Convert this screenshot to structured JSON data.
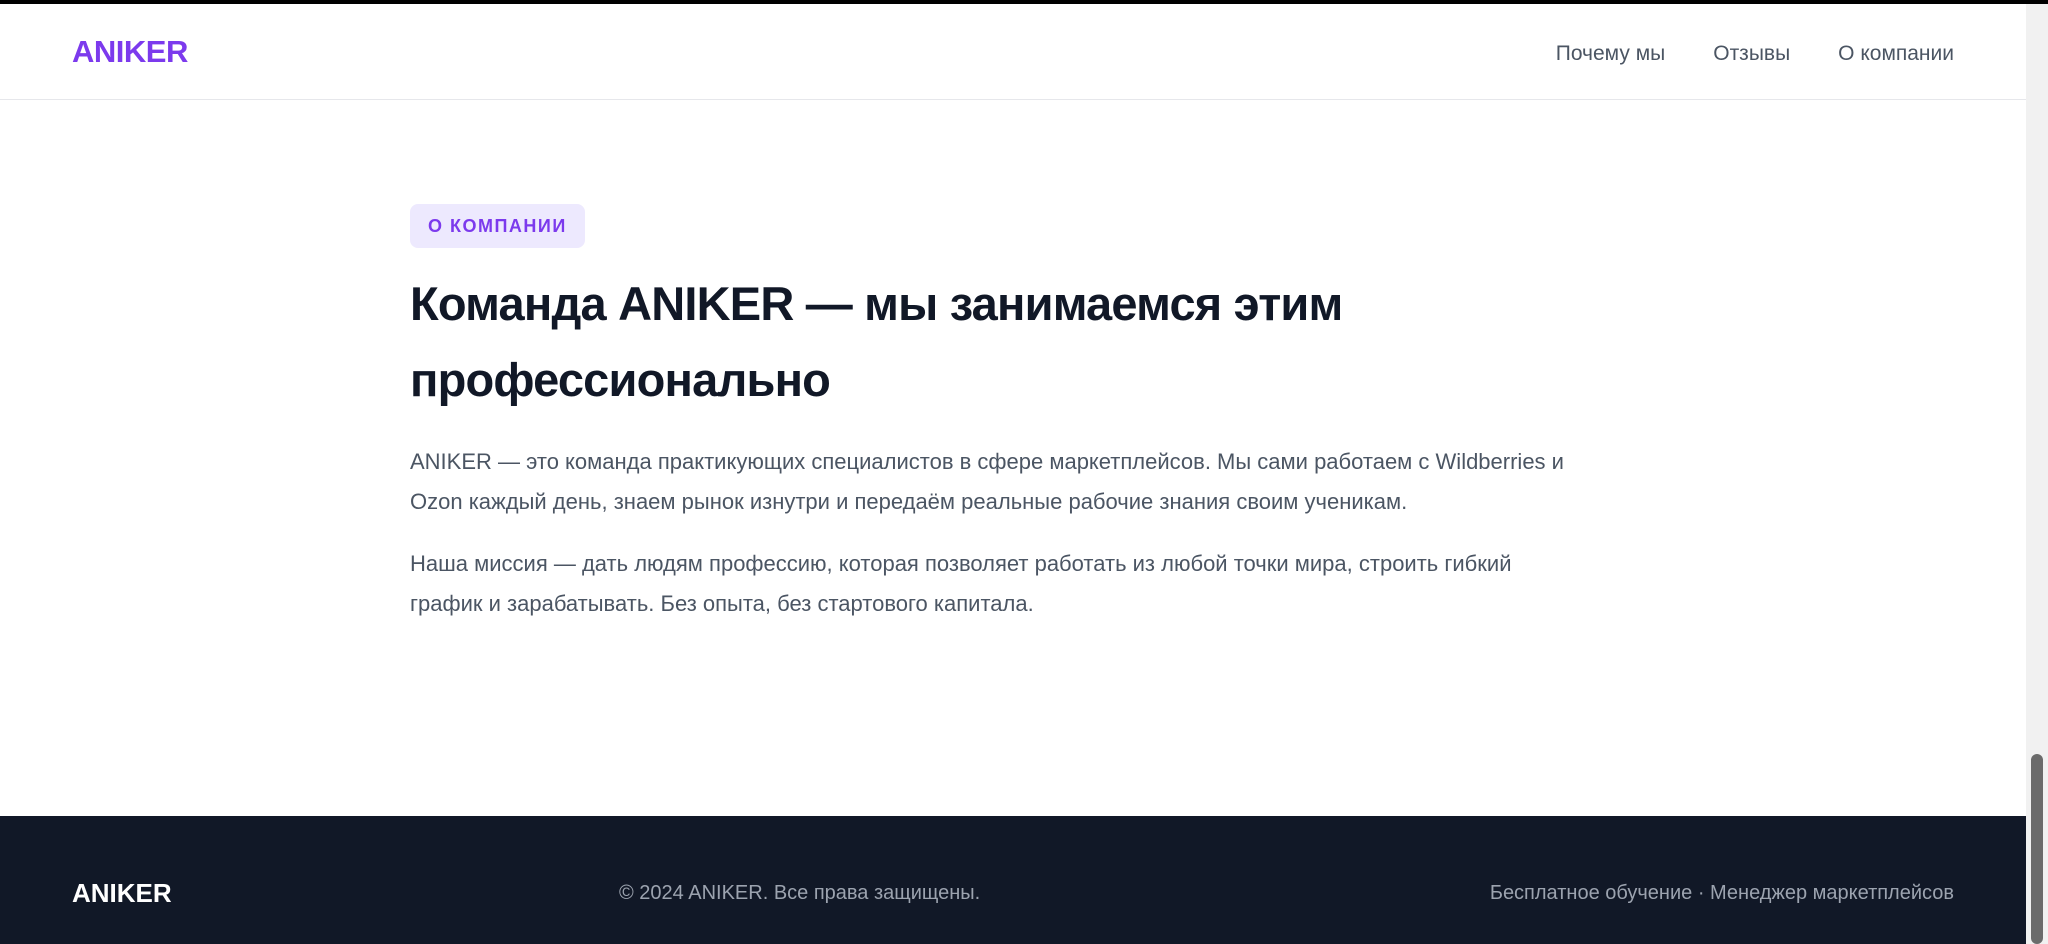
{
  "header": {
    "logo": "ANIKER",
    "nav": [
      "Почему мы",
      "Отзывы",
      "О компании"
    ]
  },
  "about": {
    "badge": "О КОМПАНИИ",
    "title": "Команда ANIKER — мы занимаемся этим профессионально",
    "paragraphs": [
      "ANIKER — это команда практикующих специалистов в сфере маркетплейсов. Мы сами работаем с Wildberries и Ozon каждый день, знаем рынок изнутри и передаём реальные рабочие знания своим ученикам.",
      "Наша миссия — дать людям профессию, которая позволяет работать из любой точки мира, строить гибкий график и зарабатывать. Без опыта, без стартового капитала."
    ]
  },
  "footer": {
    "logo": "ANIKER",
    "copyright": "© 2024 ANIKER. Все права защищены.",
    "links": "Бесплатное обучение · Менеджер маркетплейсов"
  },
  "colors": {
    "accent": "#7c3aed",
    "badge_bg": "#ede9fe",
    "footer_bg": "#111827",
    "heading": "#111827",
    "body_text": "#4b5563"
  }
}
